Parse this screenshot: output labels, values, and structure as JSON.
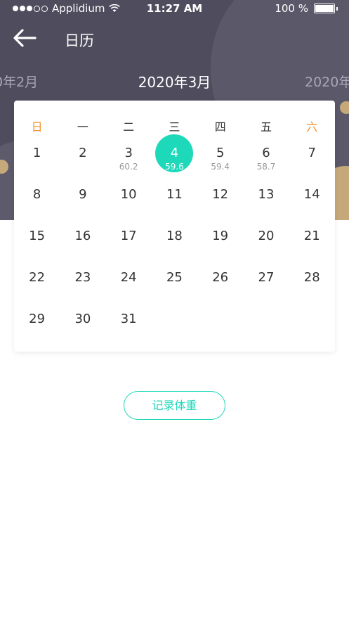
{
  "status_bar": {
    "carrier": "Applidium",
    "time": "11:27 AM",
    "battery": "100 %"
  },
  "nav": {
    "title": "日历",
    "back_icon": "arrow-left-icon"
  },
  "months": {
    "prev": "0年2月",
    "current": "2020年3月",
    "next": "2020年"
  },
  "weekdays": [
    "日",
    "一",
    "二",
    "三",
    "四",
    "五",
    "六"
  ],
  "weeks": [
    [
      {
        "day": "1",
        "weight": ""
      },
      {
        "day": "2",
        "weight": ""
      },
      {
        "day": "3",
        "weight": "60.2"
      },
      {
        "day": "4",
        "weight": "59.6",
        "selected": true
      },
      {
        "day": "5",
        "weight": "59.4"
      },
      {
        "day": "6",
        "weight": "58.7"
      },
      {
        "day": "7",
        "weight": ""
      }
    ],
    [
      {
        "day": "8",
        "weight": ""
      },
      {
        "day": "9",
        "weight": ""
      },
      {
        "day": "10",
        "weight": ""
      },
      {
        "day": "11",
        "weight": ""
      },
      {
        "day": "12",
        "weight": ""
      },
      {
        "day": "13",
        "weight": ""
      },
      {
        "day": "14",
        "weight": ""
      }
    ],
    [
      {
        "day": "15",
        "weight": ""
      },
      {
        "day": "16",
        "weight": ""
      },
      {
        "day": "17",
        "weight": ""
      },
      {
        "day": "18",
        "weight": ""
      },
      {
        "day": "19",
        "weight": ""
      },
      {
        "day": "20",
        "weight": ""
      },
      {
        "day": "21",
        "weight": ""
      }
    ],
    [
      {
        "day": "22",
        "weight": ""
      },
      {
        "day": "23",
        "weight": ""
      },
      {
        "day": "24",
        "weight": ""
      },
      {
        "day": "25",
        "weight": ""
      },
      {
        "day": "26",
        "weight": ""
      },
      {
        "day": "27",
        "weight": ""
      },
      {
        "day": "28",
        "weight": ""
      }
    ],
    [
      {
        "day": "29",
        "weight": ""
      },
      {
        "day": "30",
        "weight": ""
      },
      {
        "day": "31",
        "weight": ""
      }
    ]
  ],
  "record_button": {
    "label": "记录体重"
  },
  "colors": {
    "header": "#4f4d5d",
    "accent": "#1ed8ba",
    "weekend": "#f2932e",
    "gold": "#c6a97a"
  }
}
